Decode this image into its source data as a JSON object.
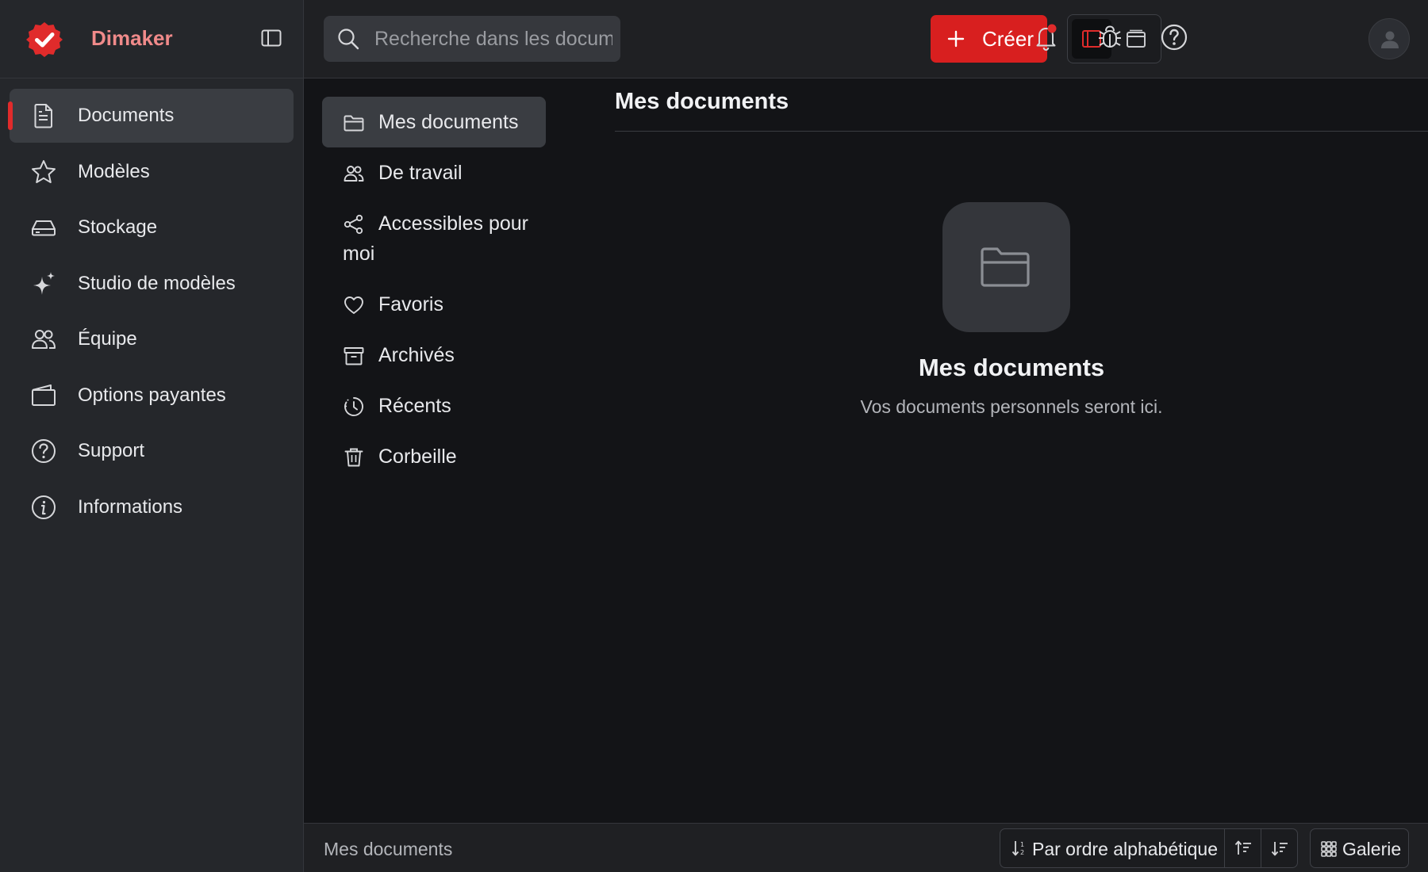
{
  "app": {
    "name": "Dimaker",
    "brand_color": "#e02b2b",
    "brand_text_color": "#f08a8a"
  },
  "sidebar": {
    "items": [
      {
        "label": "Documents",
        "icon": "document-icon",
        "active": true
      },
      {
        "label": "Modèles",
        "icon": "star-icon"
      },
      {
        "label": "Stockage",
        "icon": "storage-drive-icon"
      },
      {
        "label": "Studio de modèles",
        "icon": "sparkle-icon"
      },
      {
        "label": "Équipe",
        "icon": "team-icon"
      },
      {
        "label": "Options payantes",
        "icon": "wallet-icon"
      },
      {
        "label": "Support",
        "icon": "question-circle-icon"
      },
      {
        "label": "Informations",
        "icon": "info-circle-icon"
      }
    ]
  },
  "topbar": {
    "search_placeholder": "Recherche dans les documents",
    "create_label": "Créer",
    "icons": [
      "sidebar-layout-icon",
      "tabs-layout-icon",
      "bell-icon",
      "bug-icon",
      "help-icon",
      "user-icon"
    ],
    "notification_dot_color": "#e02b2b"
  },
  "subnav": {
    "items": [
      {
        "label": "Mes documents",
        "icon": "folder-icon",
        "active": true
      },
      {
        "label": "De travail",
        "icon": "people-icon"
      },
      {
        "label": "Accessibles pour moi",
        "icon": "share-icon"
      },
      {
        "label": "Favoris",
        "icon": "heart-icon"
      },
      {
        "label": "Archivés",
        "icon": "archive-icon"
      },
      {
        "label": "Récents",
        "icon": "clock-icon"
      },
      {
        "label": "Corbeille",
        "icon": "trash-icon"
      }
    ]
  },
  "main": {
    "title": "Mes documents",
    "empty_title": "Mes documents",
    "empty_subtitle": "Vos documents personnels seront ici."
  },
  "footer": {
    "path": "Mes documents",
    "sort_label": "Par ordre alphabétique",
    "view_label": "Galerie"
  }
}
